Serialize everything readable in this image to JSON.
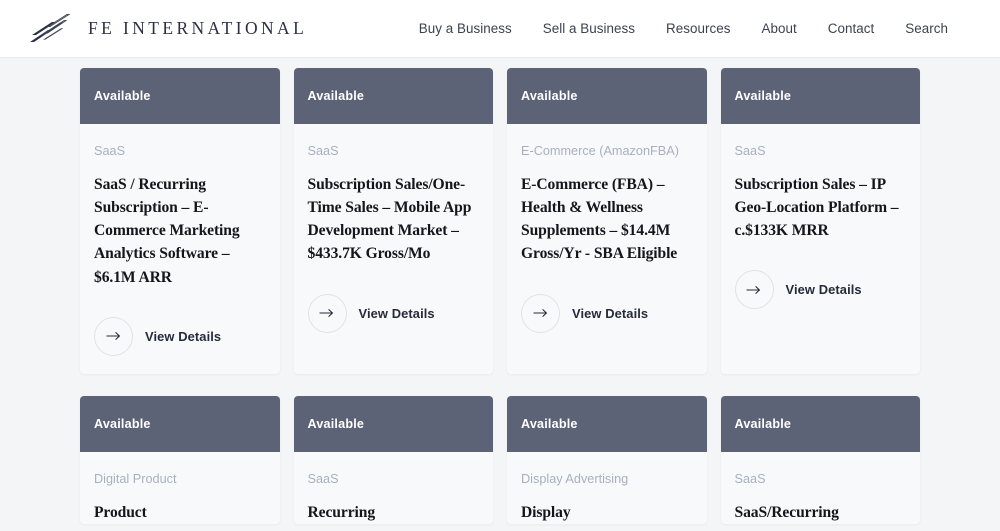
{
  "header": {
    "brand_name": "FE INTERNATIONAL",
    "logo_icon": "diagonal-slashes-logo",
    "nav": [
      {
        "label": "Buy a Business"
      },
      {
        "label": "Sell a Business"
      },
      {
        "label": "Resources"
      },
      {
        "label": "About"
      },
      {
        "label": "Contact"
      },
      {
        "label": "Search"
      }
    ]
  },
  "listings": {
    "cta_label": "View Details",
    "cta_icon": "arrow-right-icon",
    "cards": [
      {
        "status": "Available",
        "category": "SaaS",
        "title": "SaaS / Recurring Subscription – E-Commerce Marketing Analytics Software – $6.1M ARR"
      },
      {
        "status": "Available",
        "category": "SaaS",
        "title": "Subscription Sales/One-Time Sales – Mobile App Development Market – $433.7K Gross/Mo"
      },
      {
        "status": "Available",
        "category": "E-Commerce (AmazonFBA)",
        "title": "E-Commerce (FBA) – Health & Wellness Supplements – $14.4M Gross/Yr - SBA Eligible"
      },
      {
        "status": "Available",
        "category": "SaaS",
        "title": "Subscription Sales – IP Geo-Location Platform – c.$133K MRR"
      },
      {
        "status": "Available",
        "category": "Digital Product",
        "title": "Product"
      },
      {
        "status": "Available",
        "category": "SaaS",
        "title": "Recurring"
      },
      {
        "status": "Available",
        "category": "Display Advertising",
        "title": "Display"
      },
      {
        "status": "Available",
        "category": "SaaS",
        "title": "SaaS/Recurring"
      }
    ]
  },
  "colors": {
    "page_background": "#f4f5f7",
    "card_background": "#f8f9fa",
    "status_bar": "#5d6377",
    "category_text": "#a8b0c0",
    "title_text": "#15161c",
    "brand_text": "#2b3044"
  }
}
